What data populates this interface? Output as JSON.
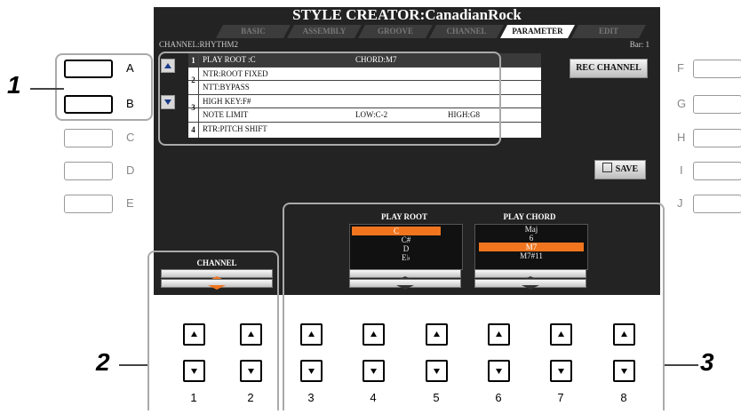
{
  "screen": {
    "title": "STYLE CREATOR:CanadianRock",
    "tabs": [
      "BASIC",
      "ASSEMBLY",
      "GROOVE",
      "CHANNEL",
      "PARAMETER",
      "EDIT"
    ],
    "active_tab": "PARAMETER",
    "channel_info": "CHANNEL:RHYTHM2",
    "bar_info": "Bar:  1",
    "param_list": [
      {
        "group": "1",
        "name": "PLAY ROOT    :C",
        "col2": "CHORD:M7",
        "col3": "",
        "selected": true
      },
      {
        "group": "2",
        "name": "NTR:ROOT FIXED",
        "col2": "",
        "col3": ""
      },
      {
        "group": "",
        "name": "NTT:BYPASS",
        "col2": "",
        "col3": ""
      },
      {
        "group": "3",
        "name": "HIGH KEY:F#",
        "col2": "",
        "col3": ""
      },
      {
        "group": "",
        "name": "NOTE LIMIT",
        "col2": "LOW:C-2",
        "col3": "HIGH:G8"
      },
      {
        "group": "4",
        "name": "RTR:PITCH SHIFT",
        "col2": "",
        "col3": ""
      }
    ],
    "rec_channel_label": "REC CHANNEL",
    "save_label": "SAVE",
    "channel_label": "CHANNEL",
    "play_root": {
      "label": "PLAY ROOT",
      "options": [
        "C",
        "C#",
        "D",
        "E♭"
      ],
      "selected": "C"
    },
    "play_chord": {
      "label": "PLAY CHORD",
      "options": [
        "Maj",
        "6",
        "M7",
        "M7#11"
      ],
      "selected": "M7"
    },
    "accent_color": "#f0751e"
  },
  "left_buttons": [
    {
      "letter": "A",
      "emphasized": true
    },
    {
      "letter": "B",
      "emphasized": true
    },
    {
      "letter": "C",
      "emphasized": false
    },
    {
      "letter": "D",
      "emphasized": false
    },
    {
      "letter": "E",
      "emphasized": false
    }
  ],
  "right_buttons": [
    "F",
    "G",
    "H",
    "I",
    "J"
  ],
  "bottom_numbers": [
    "1",
    "2",
    "3",
    "4",
    "5",
    "6",
    "7",
    "8"
  ],
  "callouts": [
    "1",
    "2",
    "3"
  ]
}
